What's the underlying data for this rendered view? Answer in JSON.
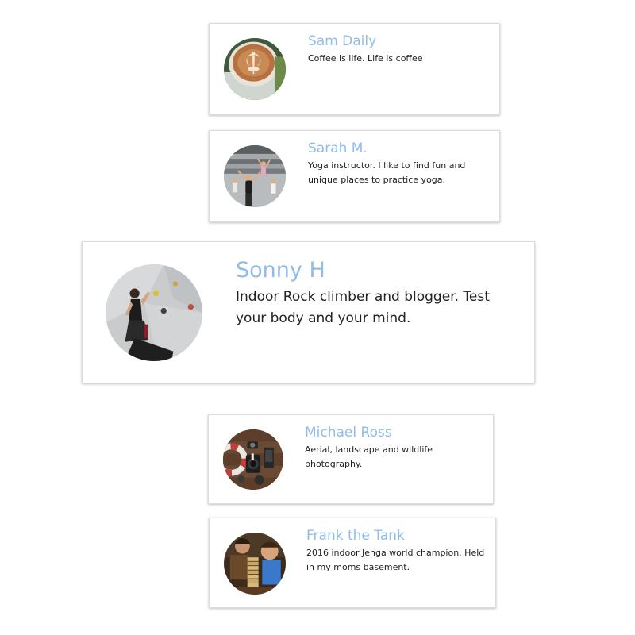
{
  "profiles": [
    {
      "name": "Sam Daily",
      "bio": "Coffee is life. Life is coffee",
      "avatar": "coffee-latte-photo"
    },
    {
      "name": "Sarah M.",
      "bio": "Yoga instructor. I like to find fun and unique places to practice yoga.",
      "avatar": "yoga-class-photo"
    },
    {
      "name": "Sonny H",
      "bio": "Indoor Rock climber and blogger. Test your body and your mind.",
      "avatar": "rock-climber-photo"
    },
    {
      "name": "Michael Ross",
      "bio": "Aerial, landscape and wildlife photography.",
      "avatar": "camera-gear-photo"
    },
    {
      "name": "Frank the Tank",
      "bio": "2016 indoor Jenga world champion. Held in my moms basement.",
      "avatar": "jenga-players-photo"
    }
  ],
  "colors": {
    "name": "#8fbcec",
    "bio": "#222222",
    "card_border": "#dcdcdc"
  }
}
